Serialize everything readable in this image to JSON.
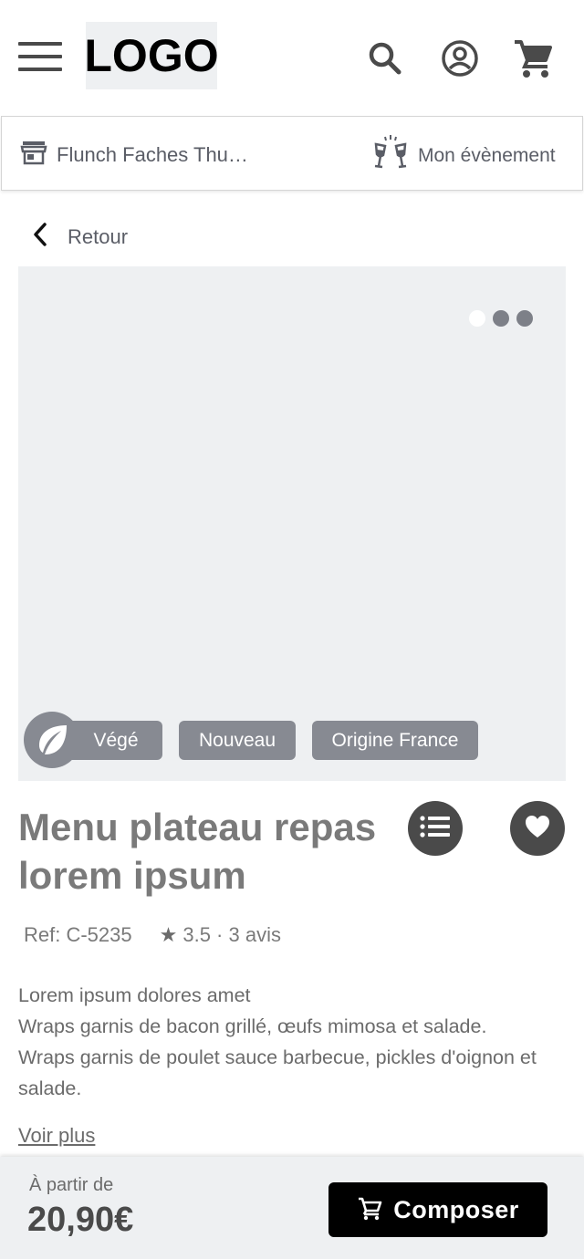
{
  "header": {
    "logo_text": "LOGO",
    "icons": [
      "menu-icon",
      "search-icon",
      "account-icon",
      "cart-icon"
    ]
  },
  "storebar": {
    "store_label": "Flunch Faches Thu…",
    "event_label": "Mon évènement"
  },
  "nav": {
    "back_label": "Retour"
  },
  "carousel": {
    "slide_count": 3,
    "active_index": 0
  },
  "product": {
    "tags": [
      "Végé",
      "Nouveau",
      "Origine France"
    ],
    "title": "Menu plateau repas lorem ipsum",
    "ref": "Ref: C-5235",
    "rating": "3.5 · 3 avis",
    "description": [
      "Lorem ipsum dolores amet",
      "Wraps garnis de bacon grillé, œufs mimosa et salade.",
      "Wraps garnis de poulet sauce barbecue, pickles d'oignon et salade."
    ],
    "more_label": "Voir plus"
  },
  "footer": {
    "from_label": "À partir de",
    "price": "20,90€",
    "compose_label": "Composer"
  },
  "colors": {
    "placeholder_bg": "#eef0f2",
    "tag_bg": "#878a92",
    "primary_button": "#000000",
    "icon_dark": "#4a4a4a"
  }
}
